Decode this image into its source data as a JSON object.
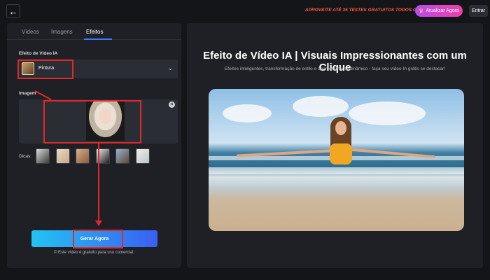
{
  "topbar": {
    "back_icon": "arrow-left-icon",
    "promo_text": "APROVEITE ATÉ 35 TESTES GRATUITOS TODOS OS DIAS!",
    "upgrade_label": "Atualizar Agora",
    "login_label": "Entrar"
  },
  "left": {
    "tabs": [
      {
        "label": "Vídeos"
      },
      {
        "label": "Imagens"
      },
      {
        "label": "Efeitos",
        "active": true
      }
    ],
    "effect_label": "Efeito de Vídeo IA",
    "effect_value": "Pintura",
    "image_label": "Imagem",
    "tips_label": "Dicas:",
    "generate_label": "Gerar Agora",
    "note": "Este vídeo é gratuito para uso comercial."
  },
  "right": {
    "title": "Efeito de Vídeo IA | Visuais Impressionantes com um Clique",
    "subtitle": "Efeitos inteligentes, transformação de estilo e aprimoramento dinâmico - faça seu vídeo IA grátis se destacar!"
  },
  "colors": {
    "accent": "#3c7bff",
    "annotation": "#e3282a",
    "promo": "#ff5a3c"
  }
}
